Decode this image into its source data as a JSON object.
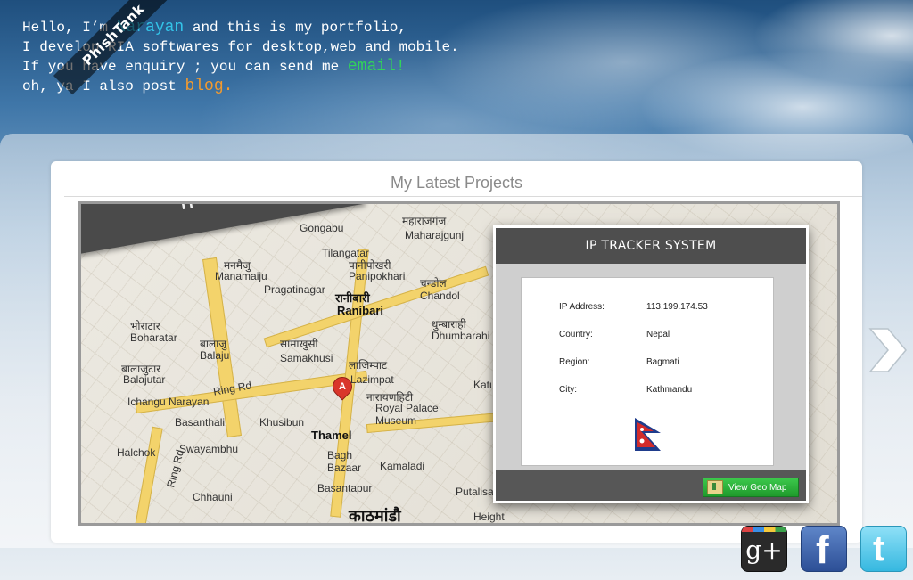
{
  "intro": {
    "line1_prefix": "Hello, I’m ",
    "name": "Narayan",
    "line1_suffix": " and this is my portfolio,",
    "line2": "I develop RIA softwares for desktop,web and mobile.",
    "line3_prefix": "If you have enquiry ; you can send me ",
    "email_link": "email!",
    "line4_prefix": "oh, ya I also post ",
    "blog_link": "blog."
  },
  "watermark": "PhishTank",
  "projects": {
    "title": "My Latest Projects",
    "slide": {
      "banner": "IP TRACKER S",
      "map_labels": [
        "Tilangatar",
        "महाराजगंज",
        "Maharajgunj",
        "मनमैजु",
        "Manamaiju",
        "पानीपोखरी",
        "Panipokhari",
        "Pragatinagar",
        "चन्डोल",
        "Chandol",
        "रानीबारी",
        "Ranibari",
        "भोराटार",
        "Boharatar",
        "बालाजु",
        "Balaju",
        "सामाखुसी",
        "Samakhusi",
        "धुम्बाराही",
        "Dhumbarahi",
        "बालाजुटार",
        "Balajutar",
        "लाजिम्पाट",
        "Lazimpat",
        "Ring Rd",
        "Ichangu Narayan",
        "Basanthali",
        "नारायणहिटी",
        "Royal Palace Museum",
        "Khusibun",
        "Thamel",
        "Swayambhu",
        "Halchok",
        "Bagh Bazaar",
        "Kamaladi",
        "Chhauni",
        "Basantapur",
        "काठमांडौ",
        "Katub",
        "Putalisa",
        "Height",
        "Ring Rd",
        "Gongabu"
      ],
      "pin_letter": "A"
    },
    "popup": {
      "title": "IP TRACKER SYSTEM",
      "rows": [
        {
          "key": "IP Address:",
          "value": "113.199.174.53"
        },
        {
          "key": "Country:",
          "value": "Nepal"
        },
        {
          "key": "Region:",
          "value": "Bagmati"
        },
        {
          "key": "City:",
          "value": "Kathmandu"
        }
      ],
      "button_label": "View Geo Map"
    }
  },
  "social": {
    "gplus_label": "g+",
    "facebook_label": "f",
    "twitter_label": "t"
  },
  "colors": {
    "name": "#33c3e8",
    "email": "#32d35a",
    "blog": "#f29a2e",
    "button": "#1f9a2c"
  }
}
